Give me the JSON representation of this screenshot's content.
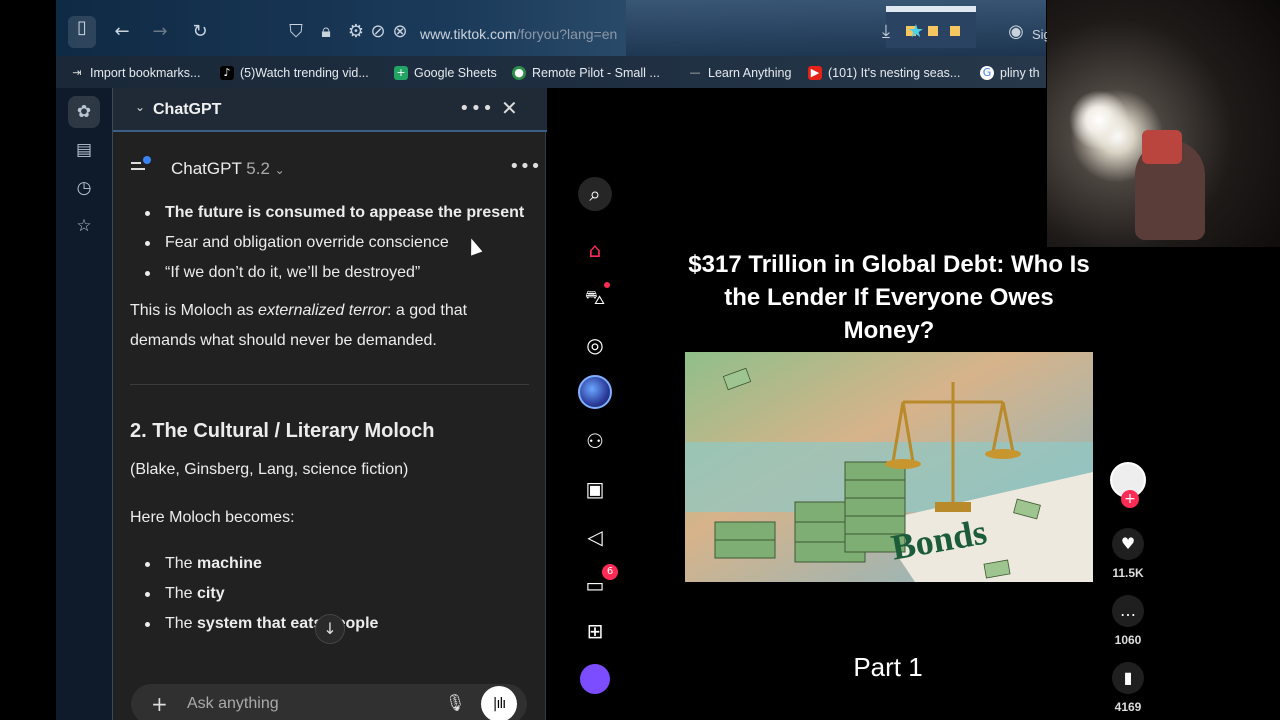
{
  "browser": {
    "url_domain": "www.tiktok.com",
    "url_path": "/foryou?lang=en",
    "sign_in": "Sig"
  },
  "bookmarks": [
    "Import bookmarks...",
    "(5)Watch trending vid...",
    "Google Sheets",
    "Remote Pilot - Small ...",
    "Learn Anything",
    "(101) It's nesting seas...",
    "pliny th"
  ],
  "panel": {
    "title": "ChatGPT",
    "model_name": "ChatGPT",
    "model_version": "5.2",
    "composer_placeholder": "Ask anything"
  },
  "message": {
    "bullets1": [
      "The future is consumed to appease the present",
      "Fear and obligation override conscience",
      "“If we don’t do it, we’ll be destroyed”"
    ],
    "para1_a": "This is Moloch as ",
    "para1_em": "externalized terror",
    "para1_b": ": a god that demands what should never be demanded.",
    "heading2": "2. The Cultural / Literary Moloch",
    "para2": "(Blake, Ginsberg, Lang, science fiction)",
    "para3": "Here Moloch becomes:",
    "bullets2": [
      {
        "pre": "The ",
        "bold": "machine"
      },
      {
        "pre": "The ",
        "bold": "city"
      },
      {
        "pre": "The ",
        "bold": "system that eats people"
      }
    ]
  },
  "tiktok": {
    "inbox_badge": "6",
    "video_title": "$317 Trillion in Global Debt: Who Is the Lender If Everyone Owes Money?",
    "image_word": "Bonds",
    "part_label": "Part 1",
    "likes": "11.5K",
    "comments": "1060",
    "saves": "4169"
  },
  "colors": {
    "tiktok_accent": "#fe2c55",
    "chatgpt_panel_bg": "#212121",
    "panel_header_border": "#3a5e86"
  }
}
